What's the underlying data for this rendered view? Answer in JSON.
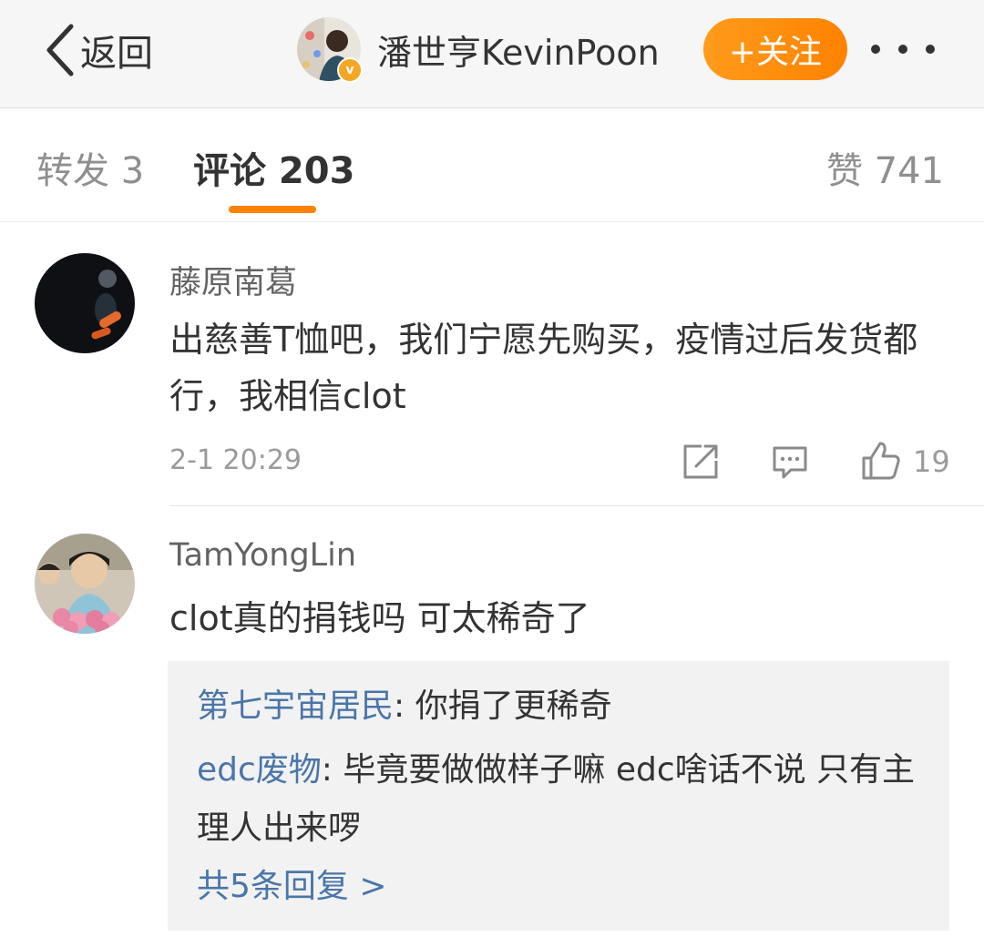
{
  "header": {
    "back_label": "返回",
    "profile_name": "潘世亨KevinPoon",
    "follow_label": "+关注",
    "verified_mark": "v"
  },
  "tabs": {
    "repost": "转发 3",
    "comment": "评论 203",
    "like": "赞 741"
  },
  "comments": [
    {
      "user": "藤原南葛",
      "text": "出慈善T恤吧，我们宁愿先购买，疫情过后发货都行，我相信clot",
      "time": "2-1 20:29",
      "likes": "19"
    },
    {
      "user": "TamYongLin",
      "text": "clot真的捐钱吗 可太稀奇了",
      "replies": [
        {
          "user": "第七宇宙居民",
          "text": ": 你捐了更稀奇"
        },
        {
          "user": "edc废物",
          "text": ": 毕竟要做做样子嘛 edc啥话不说 只有主理人出来啰"
        }
      ],
      "more_replies": "共5条回复 >"
    }
  ],
  "colors": {
    "accent": "#ff8200",
    "link": "#4a76a8",
    "header_bg": "#f6f6f6",
    "reply_bg": "#f2f2f2"
  }
}
